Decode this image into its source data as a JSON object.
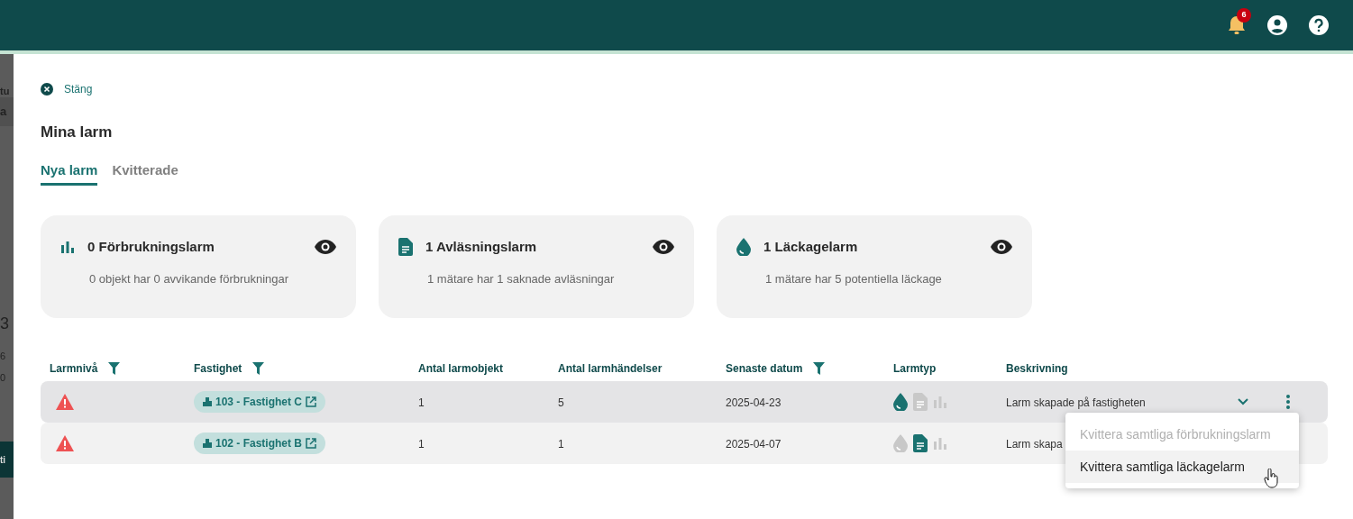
{
  "topbar": {
    "notification_count": "6"
  },
  "background_fragments": [
    "tu",
    "a",
    "3",
    "6",
    "0",
    "ti"
  ],
  "drawer": {
    "close_label": "Stäng",
    "title": "Mina larm",
    "tabs": [
      {
        "label": "Nya larm",
        "selected": true
      },
      {
        "label": "Kvitterade",
        "selected": false
      }
    ],
    "cards": [
      {
        "kind": "consumption",
        "title": "0 Förbrukningslarm",
        "subtitle": "0 objekt har 0 avvikande förbrukningar"
      },
      {
        "kind": "reading",
        "title": "1 Avläsningslarm",
        "subtitle": "1 mätare har 1 saknade avläsningar"
      },
      {
        "kind": "leak",
        "title": "1 Läckagelarm",
        "subtitle": "1 mätare har 5 potentiella läckage"
      }
    ],
    "table": {
      "columns": [
        {
          "label": "Larmnivå",
          "filter": true
        },
        {
          "label": "Fastighet",
          "filter": true
        },
        {
          "label": "Antal larmobjekt",
          "filter": false
        },
        {
          "label": "Antal larmhändelser",
          "filter": false
        },
        {
          "label": "Senaste datum",
          "filter": true
        },
        {
          "label": "Larmtyp",
          "filter": false
        },
        {
          "label": "Beskrivning",
          "filter": false
        }
      ],
      "rows": [
        {
          "selected": true,
          "property": "103 - Fastighet C",
          "objects": "1",
          "events": "5",
          "date": "2025-04-23",
          "types": [
            {
              "kind": "leak",
              "active": true
            },
            {
              "kind": "reading",
              "active": false
            },
            {
              "kind": "consumption",
              "active": false
            }
          ],
          "description": "Larm skapade på fastigheten",
          "actions": true
        },
        {
          "selected": false,
          "property": "102 - Fastighet B",
          "objects": "1",
          "events": "1",
          "date": "2025-04-07",
          "types": [
            {
              "kind": "leak",
              "active": false
            },
            {
              "kind": "reading",
              "active": true
            },
            {
              "kind": "consumption",
              "active": false
            }
          ],
          "description": "Larm skapa",
          "actions": false
        }
      ]
    },
    "menu": {
      "items": [
        {
          "label": "Kvittera samtliga förbrukningslarm",
          "disabled": true,
          "hovered": false
        },
        {
          "label": "Kvittera samtliga läckagelarm",
          "disabled": false,
          "hovered": true
        }
      ]
    }
  }
}
